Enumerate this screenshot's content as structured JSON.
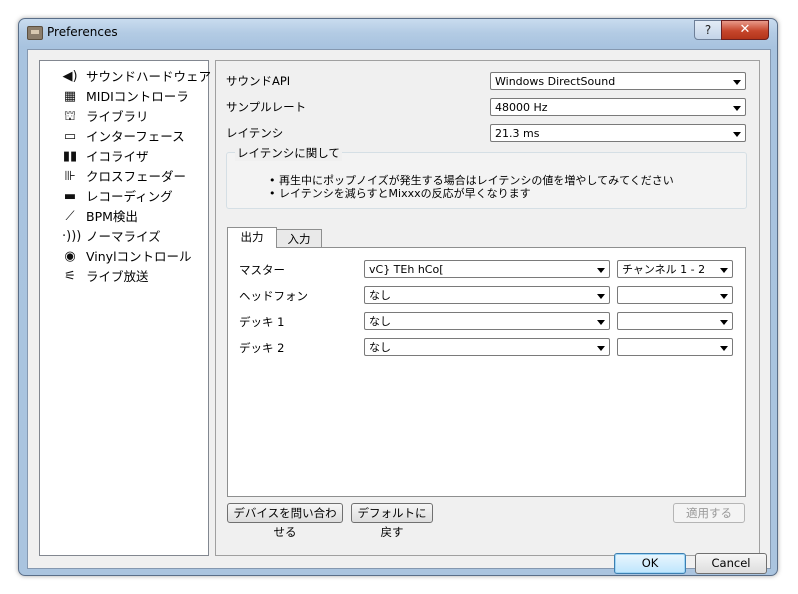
{
  "window": {
    "title": "Preferences",
    "help_label": "?",
    "close_label": "✕"
  },
  "sidebar": {
    "items": [
      {
        "label": "サウンドハードウェア",
        "icon": "speaker-icon",
        "glyph": "◀)"
      },
      {
        "label": "MIDIコントローラ",
        "icon": "midi-controller-icon",
        "glyph": "▦"
      },
      {
        "label": "ライブラリ",
        "icon": "library-icon",
        "glyph": "⛫"
      },
      {
        "label": "インターフェース",
        "icon": "monitor-icon",
        "glyph": "▭"
      },
      {
        "label": "イコライザ",
        "icon": "equalizer-icon",
        "glyph": "▮▮"
      },
      {
        "label": "クロスフェーダー",
        "icon": "crossfader-icon",
        "glyph": "⊪"
      },
      {
        "label": "レコーディング",
        "icon": "recording-icon",
        "glyph": "▬"
      },
      {
        "label": "BPM検出",
        "icon": "bpm-icon",
        "glyph": "⟋"
      },
      {
        "label": "ノーマライズ",
        "icon": "normalize-icon",
        "glyph": "·)))"
      },
      {
        "label": "Vinylコントロール",
        "icon": "vinyl-icon",
        "glyph": "◉"
      },
      {
        "label": "ライブ放送",
        "icon": "broadcast-icon",
        "glyph": "⚟"
      }
    ]
  },
  "sound": {
    "api_label": "サウンドAPI",
    "api_value": "Windows DirectSound",
    "rate_label": "サンプルレート",
    "rate_value": "48000 Hz",
    "latency_label": "レイテンシ",
    "latency_value": "21.3 ms"
  },
  "about_latency": {
    "title": "レイテンシに関して",
    "line1": "• 再生中にポップノイズが発生する場合はレイテンシの値を増やしてみてください",
    "line2": "• レイテンシを減らすとMixxxの反応が早くなります"
  },
  "tabs": {
    "output": "出力",
    "input": "入力"
  },
  "outputs": [
    {
      "label": "マスター",
      "device": "vC} TEh hCo[",
      "channel": "チャンネル 1 - 2"
    },
    {
      "label": "ヘッドフォン",
      "device": "なし",
      "channel": ""
    },
    {
      "label": "デッキ 1",
      "device": "なし",
      "channel": ""
    },
    {
      "label": "デッキ 2",
      "device": "なし",
      "channel": ""
    }
  ],
  "buttons": {
    "query_devices": "デバイスを問い合わせる",
    "reset_defaults": "デフォルトに戻す",
    "apply": "適用する",
    "ok": "OK",
    "cancel": "Cancel"
  }
}
